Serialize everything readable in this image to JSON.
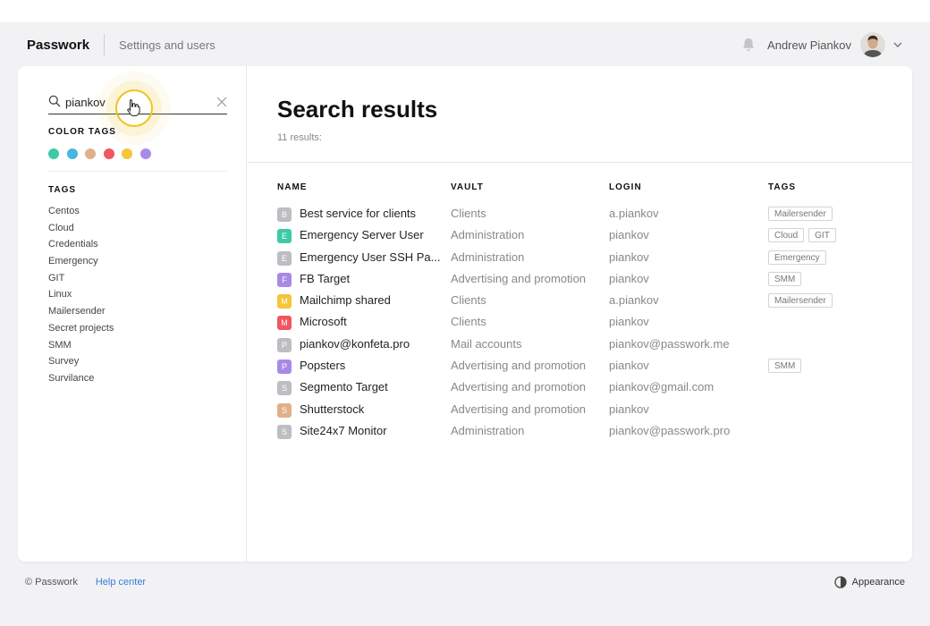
{
  "header": {
    "logo": "Passwork",
    "settings_link": "Settings and users",
    "user_name": "Andrew Piankov"
  },
  "sidebar": {
    "search_value": "piankov",
    "color_tags_title": "COLOR TAGS",
    "colors": [
      "#3ec9a7",
      "#46b6e0",
      "#e0b08a",
      "#f0575e",
      "#f5c53a",
      "#a88ae6"
    ],
    "tags_title": "TAGS",
    "tags": [
      "Centos",
      "Cloud",
      "Credentials",
      "Emergency",
      "GIT",
      "Linux",
      "Mailersender",
      "Secret projects",
      "SMM",
      "Survey",
      "Survilance"
    ]
  },
  "main": {
    "title": "Search results",
    "count": "11 results:",
    "columns": {
      "name": "NAME",
      "vault": "VAULT",
      "login": "LOGIN",
      "tags": "TAGS"
    },
    "rows": [
      {
        "letter": "B",
        "color": "#bdbdc2",
        "name": "Best service for clients",
        "vault": "Clients",
        "login": "a.piankov",
        "tags": [
          "Mailersender"
        ]
      },
      {
        "letter": "E",
        "color": "#3ec9a7",
        "name": "Emergency Server User",
        "vault": "Administration",
        "login": "piankov",
        "tags": [
          "Cloud",
          "GIT"
        ]
      },
      {
        "letter": "E",
        "color": "#bdbdc2",
        "name": "Emergency User SSH Pa...",
        "vault": "Administration",
        "login": "piankov",
        "tags": [
          "Emergency"
        ]
      },
      {
        "letter": "F",
        "color": "#a88ae6",
        "name": "FB Target",
        "vault": "Advertising and promotion",
        "login": "piankov",
        "tags": [
          "SMM"
        ]
      },
      {
        "letter": "M",
        "color": "#f5c53a",
        "name": "Mailchimp shared",
        "vault": "Clients",
        "login": "a.piankov",
        "tags": [
          "Mailersender"
        ]
      },
      {
        "letter": "M",
        "color": "#f0575e",
        "name": "Microsoft",
        "vault": "Clients",
        "login": "piankov",
        "tags": []
      },
      {
        "letter": "P",
        "color": "#bdbdc2",
        "name": "piankov@konfeta.pro",
        "vault": "Mail accounts",
        "login": "piankov@passwork.me",
        "tags": []
      },
      {
        "letter": "P",
        "color": "#a88ae6",
        "name": "Popsters",
        "vault": "Advertising and promotion",
        "login": "piankov",
        "tags": [
          "SMM"
        ]
      },
      {
        "letter": "S",
        "color": "#bdbdc2",
        "name": "Segmento Target",
        "vault": "Advertising and promotion",
        "login": "piankov@gmail.com",
        "tags": []
      },
      {
        "letter": "S",
        "color": "#e0b08a",
        "name": "Shutterstock",
        "vault": "Advertising and promotion",
        "login": "piankov",
        "tags": []
      },
      {
        "letter": "S",
        "color": "#bdbdc2",
        "name": "Site24x7 Monitor",
        "vault": "Administration",
        "login": "piankov@passwork.pro",
        "tags": []
      }
    ]
  },
  "footer": {
    "copyright": "© Passwork",
    "help": "Help center",
    "appearance": "Appearance"
  }
}
